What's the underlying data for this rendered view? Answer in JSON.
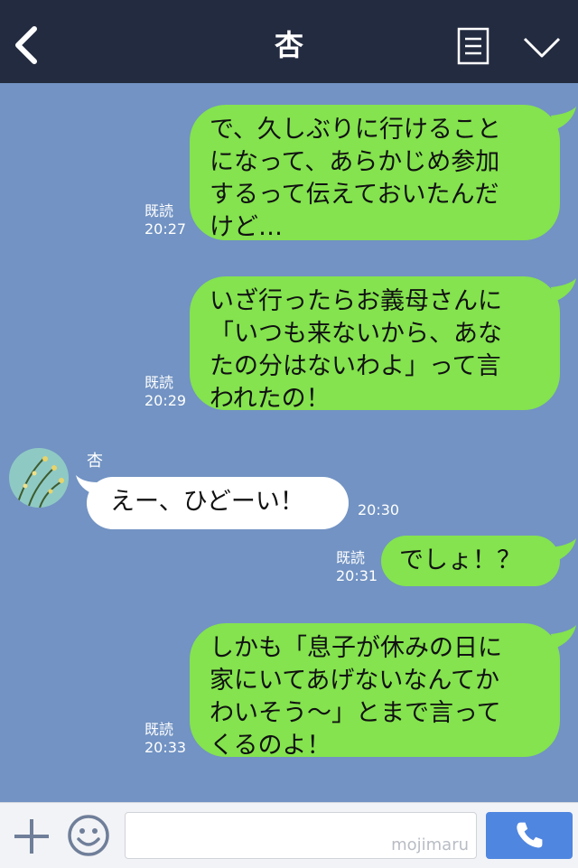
{
  "header": {
    "title": "杏"
  },
  "messages": [
    {
      "text": "で、久しぶりに行けること\nになって、あらかじめ参加\nするって伝えておいたんだ\nけど…",
      "read": "既読",
      "time": "20:27"
    },
    {
      "text": "いざ行ったらお義母さんに\n「いつも来ないから、あな\nたの分はないわよ」って言\nわれたの！",
      "read": "既読",
      "time": "20:29"
    },
    {
      "sender": "杏",
      "text": "えー、ひどーい！",
      "time": "20:30"
    },
    {
      "text": "でしょ！？",
      "read": "既読",
      "time": "20:31"
    },
    {
      "text": "しかも「息子が休みの日に\n家にいてあげないなんてか\nわいそう～」とまで言って\nくるのよ！",
      "read": "既読",
      "time": "20:33"
    }
  ],
  "footer": {
    "watermark": "mojimaru"
  },
  "icons": [
    "back-arrow-icon",
    "menu-icon",
    "chevron-down-icon",
    "plus-icon",
    "emoji-icon",
    "phone-icon"
  ],
  "colors": {
    "header": "#232b40",
    "background": "#7293c3",
    "outgoing_bubble": "#84e34e",
    "incoming_bubble": "#ffffff",
    "call_button": "#4f86e0"
  }
}
